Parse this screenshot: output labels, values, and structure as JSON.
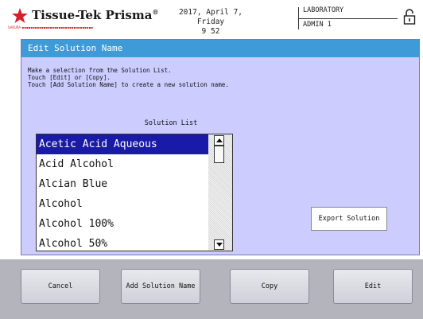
{
  "header": {
    "logo_text": "Tissue-Tek Prisma",
    "logo_reg": "®",
    "logo_tagline": "SAKURA ▪▪▪▪▪▪▪▪▪▪▪▪▪▪▪▪▪▪▪▪▪▪▪▪▪▪▪▪▪▪▪▪▪",
    "date": "2017, April 7, Friday",
    "time": "9 52",
    "user_role": "LABORATORY",
    "user_name": "ADMIN 1",
    "lock_icon": "padlock-icon"
  },
  "panel": {
    "title": "Edit Solution Name",
    "instructions": [
      "Make a selection from the Solution List.",
      "Touch [Edit] or [Copy].",
      "Touch [Add Solution Name] to create a new solution name."
    ],
    "list_label": "Solution List",
    "items": [
      {
        "label": "Acetic Acid Aqueous",
        "selected": true
      },
      {
        "label": "Acid Alcohol",
        "selected": false
      },
      {
        "label": "Alcian Blue",
        "selected": false
      },
      {
        "label": "Alcohol",
        "selected": false
      },
      {
        "label": "Alcohol 100%",
        "selected": false
      },
      {
        "label": "Alcohol 50%",
        "selected": false
      }
    ],
    "export_button": "Export Solution"
  },
  "buttons": {
    "cancel": "Cancel",
    "add": "Add Solution Name",
    "copy": "Copy",
    "edit": "Edit"
  },
  "colors": {
    "title_bar": "#3f9ad8",
    "panel_bg": "#ccccff",
    "selection": "#1a1aa8",
    "bottom_bar": "#b4b4bc",
    "logo_star": "#d8202a"
  }
}
